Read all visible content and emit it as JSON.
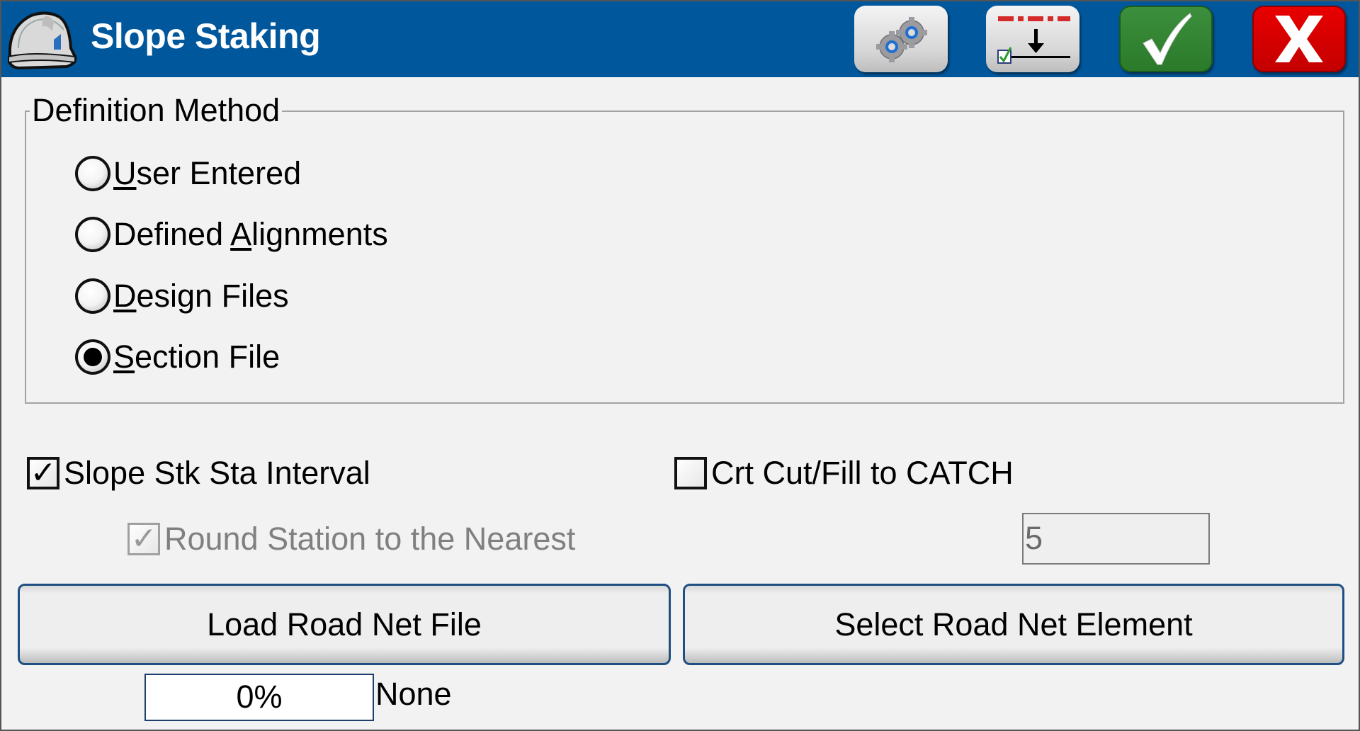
{
  "window": {
    "title": "Slope Staking",
    "app_icon": "hard-hat-icon"
  },
  "toolbar": {
    "buttons": [
      {
        "name": "settings",
        "icon": "gears-icon"
      },
      {
        "name": "stake-options",
        "icon": "stake-down-arrow-checkbox-icon"
      },
      {
        "name": "accept",
        "icon": "checkmark-icon"
      },
      {
        "name": "cancel",
        "icon": "close-x-icon"
      }
    ]
  },
  "definition_method": {
    "legend": "Definition Method",
    "options": [
      {
        "pre": "",
        "hot": "U",
        "post": "ser Entered",
        "selected": false
      },
      {
        "pre": "Defined ",
        "hot": "A",
        "post": "lignments",
        "selected": false
      },
      {
        "pre": "",
        "hot": "D",
        "post": "esign Files",
        "selected": false
      },
      {
        "pre": "",
        "hot": "S",
        "post": "ection File",
        "selected": true
      }
    ]
  },
  "options": {
    "slope_stk_sta_interval": {
      "label": "Slope Stk Sta Interval",
      "checked": true,
      "mark": "✓"
    },
    "crt_cut_fill": {
      "label": "Crt Cut/Fill to CATCH",
      "checked": false,
      "mark": ""
    },
    "round_station": {
      "label": "Round Station to the Nearest",
      "checked": true,
      "enabled": false,
      "mark": "✓"
    },
    "round_value": "5"
  },
  "actions": {
    "load_road_net_file": "Load Road Net File",
    "select_road_net_element": "Select Road Net Element"
  },
  "load_status": {
    "progress_percent": 0,
    "progress_text": "0%",
    "selected_element": "None"
  },
  "colors": {
    "titlebar": "#00579c",
    "accept": "#2e7d2e",
    "cancel": "#d40000"
  }
}
